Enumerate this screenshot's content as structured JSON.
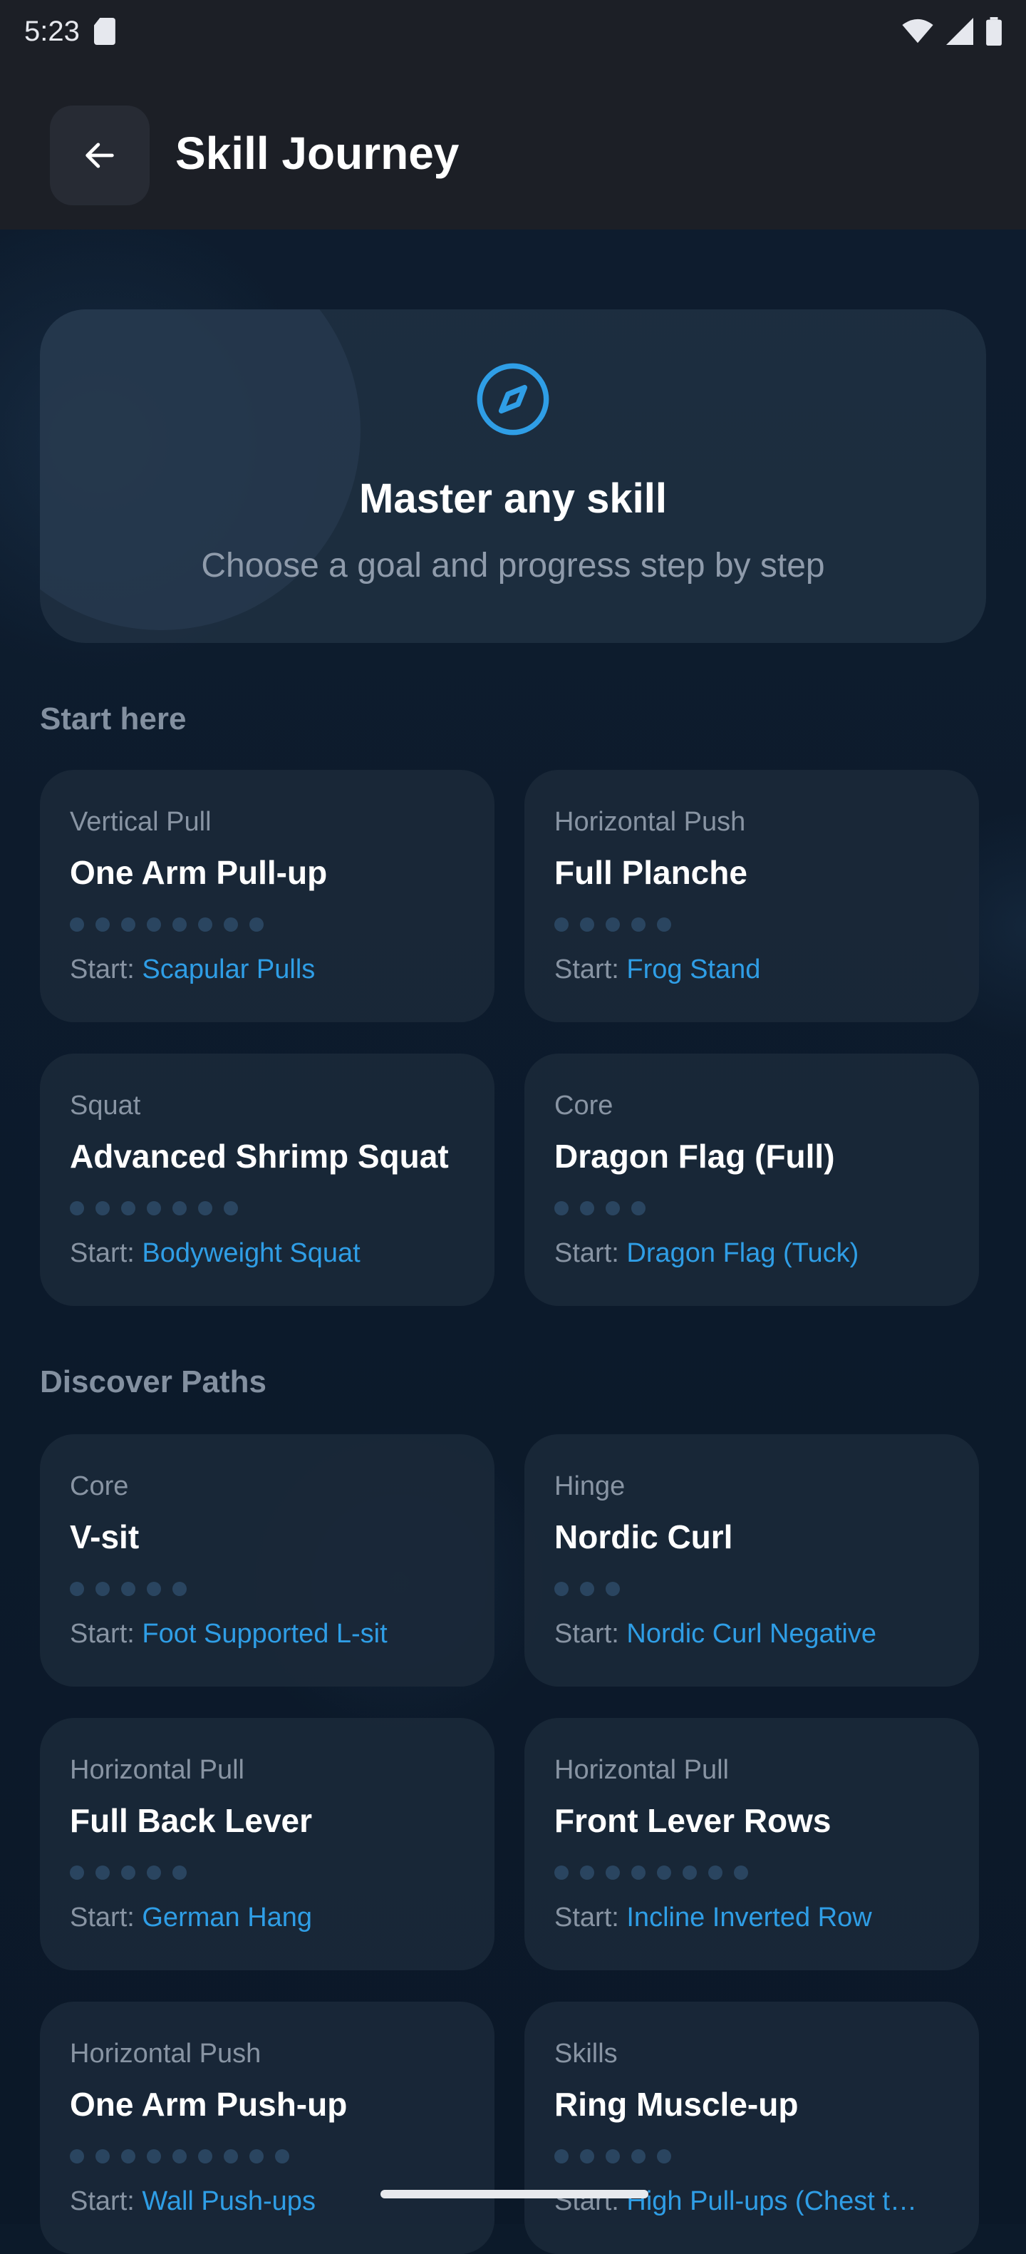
{
  "status_bar": {
    "time": "5:23",
    "sd_icon": "sd-card-icon",
    "wifi_icon": "wifi-icon",
    "signal_icon": "signal-icon",
    "battery_icon": "battery-icon"
  },
  "header": {
    "back_icon": "arrow-left-icon",
    "title": "Skill Journey"
  },
  "hero": {
    "icon": "compass-icon",
    "title": "Master any skill",
    "subtitle": "Choose a goal and progress step by step"
  },
  "start_here": {
    "title": "Start here",
    "cards": [
      {
        "category": "Vertical Pull",
        "name": "One Arm Pull-up",
        "steps": 8,
        "start_label": "Start: ",
        "start_value": "Scapular Pulls"
      },
      {
        "category": "Horizontal Push",
        "name": "Full Planche",
        "steps": 5,
        "start_label": "Start: ",
        "start_value": "Frog Stand"
      },
      {
        "category": "Squat",
        "name": "Advanced Shrimp Squat",
        "steps": 7,
        "start_label": "Start: ",
        "start_value": "Bodyweight Squat"
      },
      {
        "category": "Core",
        "name": "Dragon Flag (Full)",
        "steps": 4,
        "start_label": "Start: ",
        "start_value": "Dragon Flag (Tuck)"
      }
    ]
  },
  "discover": {
    "title": "Discover Paths",
    "cards": [
      {
        "category": "Core",
        "name": "V-sit",
        "steps": 5,
        "start_label": "Start: ",
        "start_value": "Foot Supported L-sit"
      },
      {
        "category": "Hinge",
        "name": "Nordic Curl",
        "steps": 3,
        "start_label": "Start: ",
        "start_value": "Nordic Curl Negative"
      },
      {
        "category": "Horizontal Pull",
        "name": "Full Back Lever",
        "steps": 5,
        "start_label": "Start: ",
        "start_value": "German Hang"
      },
      {
        "category": "Horizontal Pull",
        "name": "Front Lever Rows",
        "steps": 8,
        "start_label": "Start: ",
        "start_value": "Incline Inverted Row"
      },
      {
        "category": "Horizontal Push",
        "name": "One Arm Push-up",
        "steps": 9,
        "start_label": "Start: ",
        "start_value": "Wall Push-ups"
      },
      {
        "category": "Skills",
        "name": "Ring Muscle-up",
        "steps": 5,
        "start_label": "Start: ",
        "start_value": "High Pull-ups (Chest t…"
      }
    ]
  },
  "colors": {
    "accent": "#2f9ee6",
    "background": "#0c1a2a",
    "card": "#1a2838",
    "header": "#1c1f26"
  }
}
